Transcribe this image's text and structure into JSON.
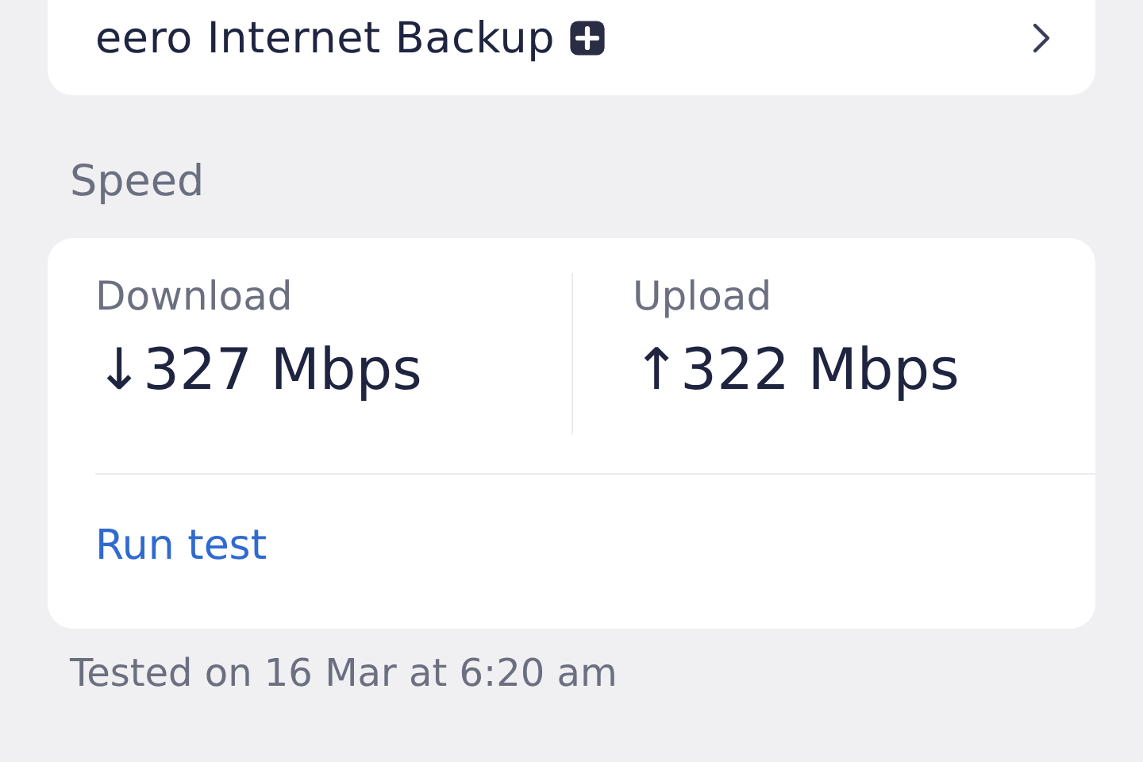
{
  "backup_row": {
    "label": "eero Internet Backup"
  },
  "speed": {
    "heading": "Speed",
    "download": {
      "label": "Download",
      "value": "↓327 Mbps"
    },
    "upload": {
      "label": "Upload",
      "value": "↑322 Mbps"
    },
    "action": "Run test"
  },
  "footer": "Tested on 16 Mar at 6:20 am"
}
